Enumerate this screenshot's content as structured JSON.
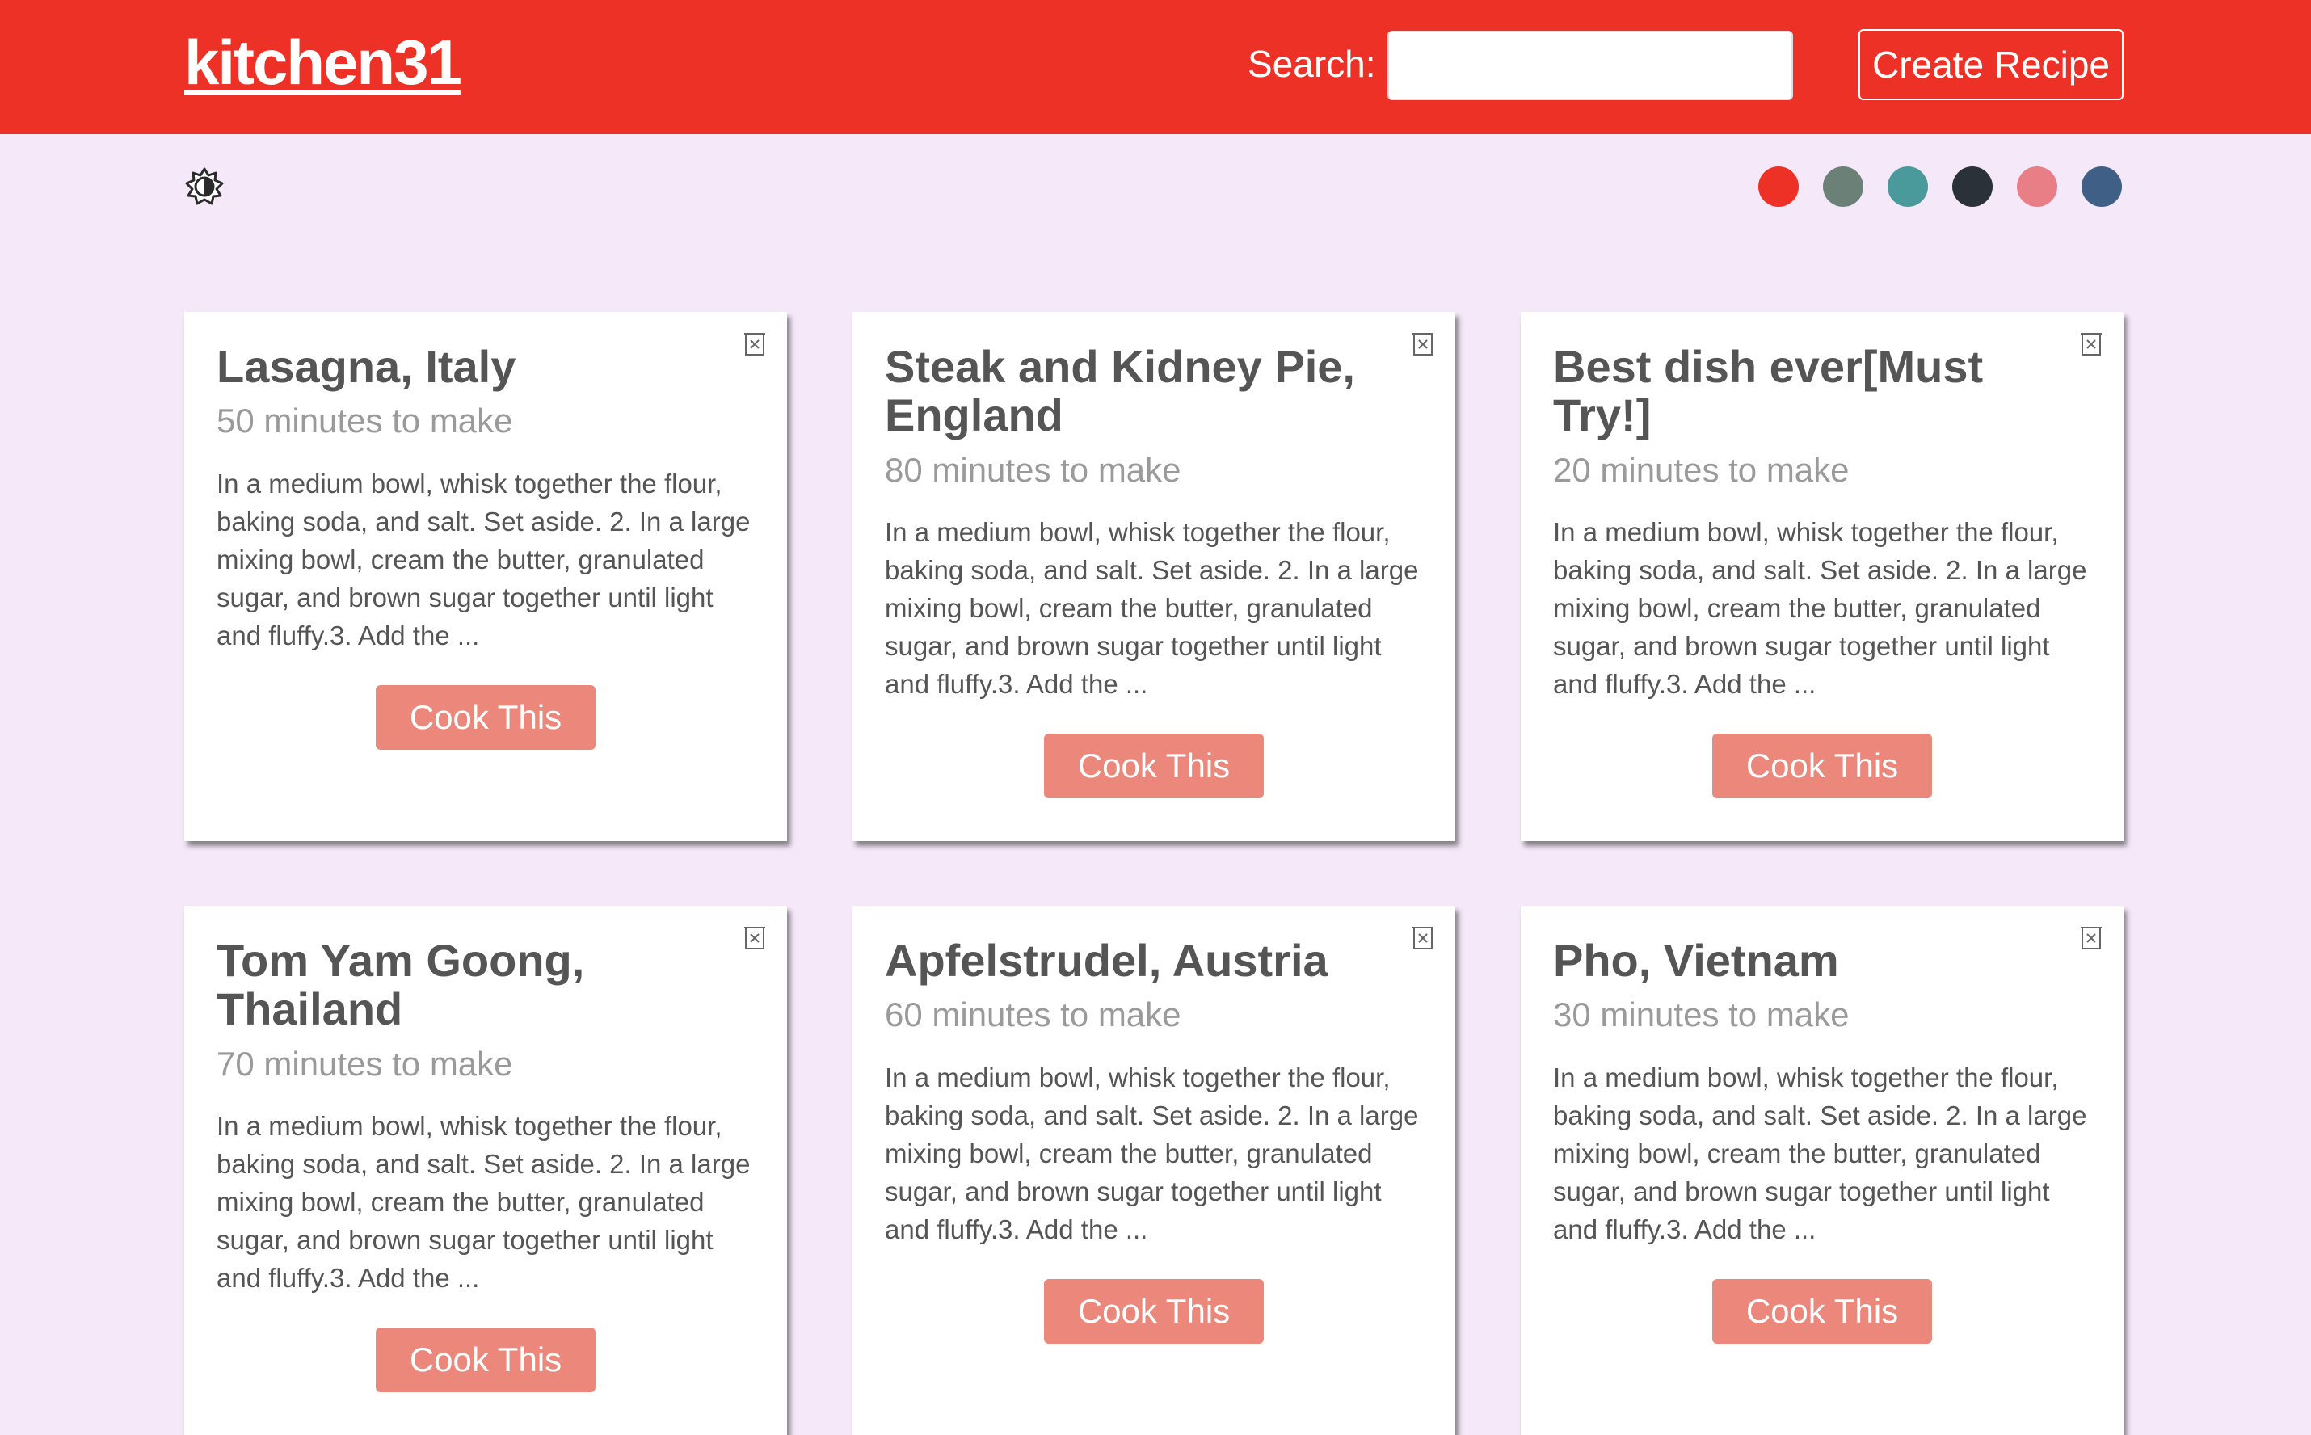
{
  "header": {
    "logo": "kitchen31",
    "search_label": "Search:",
    "search_value": "",
    "search_placeholder": "",
    "create_label": "Create Recipe"
  },
  "toolbar": {
    "theme_icon": "contrast-icon",
    "swatches": [
      "#ee3126",
      "#6b8178",
      "#4a9a9c",
      "#2b3138",
      "#e87e86",
      "#3f5f86"
    ]
  },
  "recipes": [
    {
      "title": "Lasagna, Italy",
      "time": "50 minutes to make",
      "description": "In a medium bowl, whisk together the flour, baking soda, and salt. Set aside. 2. In a large mixing bowl, cream the butter, granulated sugar, and brown sugar together until light and fluffy.3. Add the ...",
      "button": "Cook This"
    },
    {
      "title": "Steak and Kidney Pie, England",
      "time": "80 minutes to make",
      "description": "In a medium bowl, whisk together the flour, baking soda, and salt. Set aside. 2. In a large mixing bowl, cream the butter, granulated sugar, and brown sugar together until light and fluffy.3. Add the ...",
      "button": "Cook This"
    },
    {
      "title": "Best dish ever[Must Try!]",
      "time": "20 minutes to make",
      "description": "In a medium bowl, whisk together the flour, baking soda, and salt. Set aside. 2. In a large mixing bowl, cream the butter, granulated sugar, and brown sugar together until light and fluffy.3. Add the ...",
      "button": "Cook This"
    },
    {
      "title": "Tom Yam Goong, Thailand",
      "time": "70 minutes to make",
      "description": "In a medium bowl, whisk together the flour, baking soda, and salt. Set aside. 2. In a large mixing bowl, cream the butter, granulated sugar, and brown sugar together until light and fluffy.3. Add the ...",
      "button": "Cook This"
    },
    {
      "title": "Apfelstrudel, Austria",
      "time": "60 minutes to make",
      "description": "In a medium bowl, whisk together the flour, baking soda, and salt. Set aside. 2. In a large mixing bowl, cream the butter, granulated sugar, and brown sugar together until light and fluffy.3. Add the ...",
      "button": "Cook This"
    },
    {
      "title": "Pho, Vietnam",
      "time": "30 minutes to make",
      "description": "In a medium bowl, whisk together the flour, baking soda, and salt. Set aside. 2. In a large mixing bowl, cream the butter, granulated sugar, and brown sugar together until light and fluffy.3. Add the ...",
      "button": "Cook This"
    }
  ]
}
